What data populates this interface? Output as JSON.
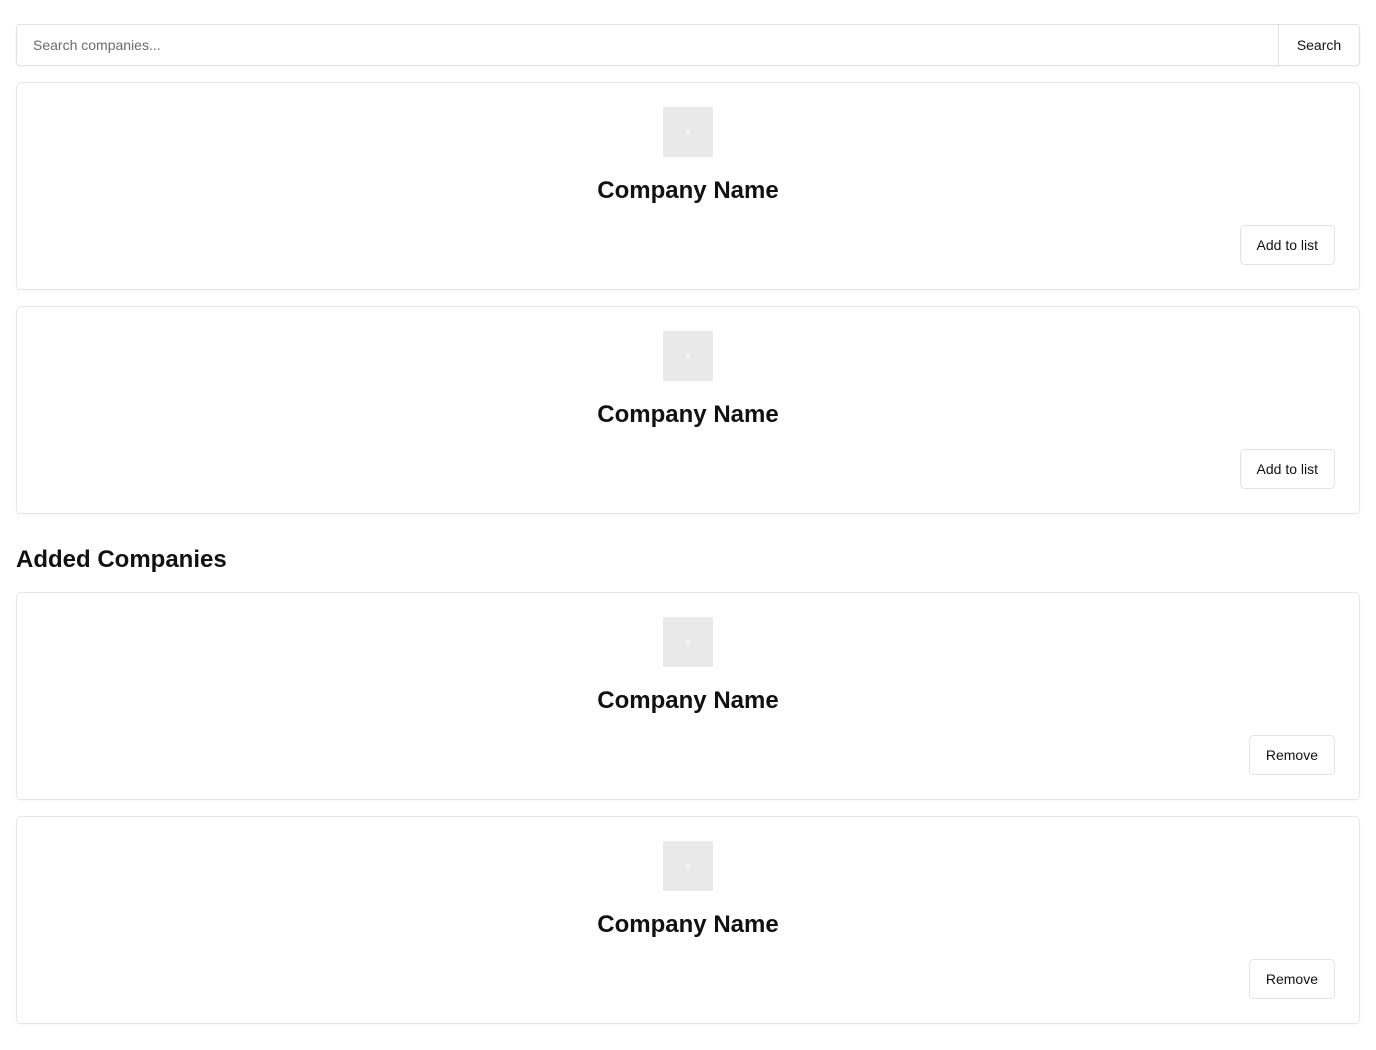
{
  "search": {
    "placeholder": "Search companies...",
    "value": "",
    "button_label": "Search"
  },
  "results": [
    {
      "name": "Company Name",
      "action_label": "Add to list"
    },
    {
      "name": "Company Name",
      "action_label": "Add to list"
    }
  ],
  "added": {
    "title": "Added Companies",
    "items": [
      {
        "name": "Company Name",
        "action_label": "Remove"
      },
      {
        "name": "Company Name",
        "action_label": "Remove"
      }
    ]
  },
  "colors": {
    "border": "#e2e2e2",
    "logo_placeholder": "#e9e9e9",
    "text": "#111111"
  }
}
